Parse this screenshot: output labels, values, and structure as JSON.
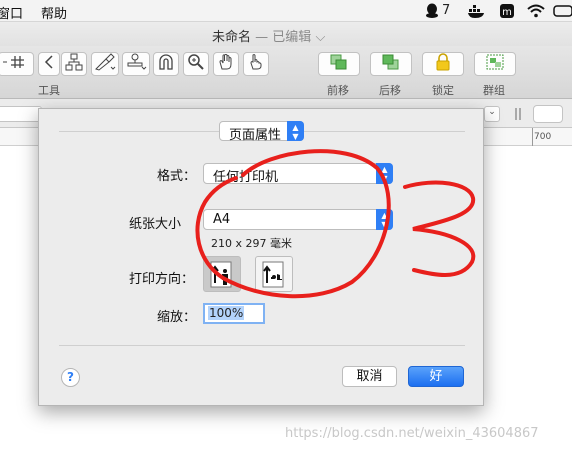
{
  "menu": {
    "window": "窗口",
    "help": "帮助",
    "qq_count": "7"
  },
  "window": {
    "title": "未命名",
    "subtitle": "— 已编辑",
    "subtitle_chevron": "⌵"
  },
  "toolbar": {
    "tools_label": "工具",
    "forward_label": "前移",
    "backward_label": "后移",
    "lock_label": "锁定",
    "group_label": "群组"
  },
  "ruler": {
    "mark_700": "700"
  },
  "dialog": {
    "section_popup": "页面属性",
    "format_label": "格式：",
    "format_value": "任何打印机",
    "paper_label": "纸张大小",
    "paper_value": "A4",
    "paper_dims": "210 x 297 毫米",
    "orientation_label": "打印方向：",
    "scale_label": "缩放：",
    "scale_value": "100%",
    "help_glyph": "?",
    "cancel_label": "取消",
    "ok_label": "好"
  },
  "annotation": {
    "text": "3",
    "color": "#e8201c"
  },
  "watermark": "https://blog.csdn.net/weixin_43604867",
  "colors": {
    "accent": "#2f7ff5",
    "annotation": "#e8201c"
  }
}
